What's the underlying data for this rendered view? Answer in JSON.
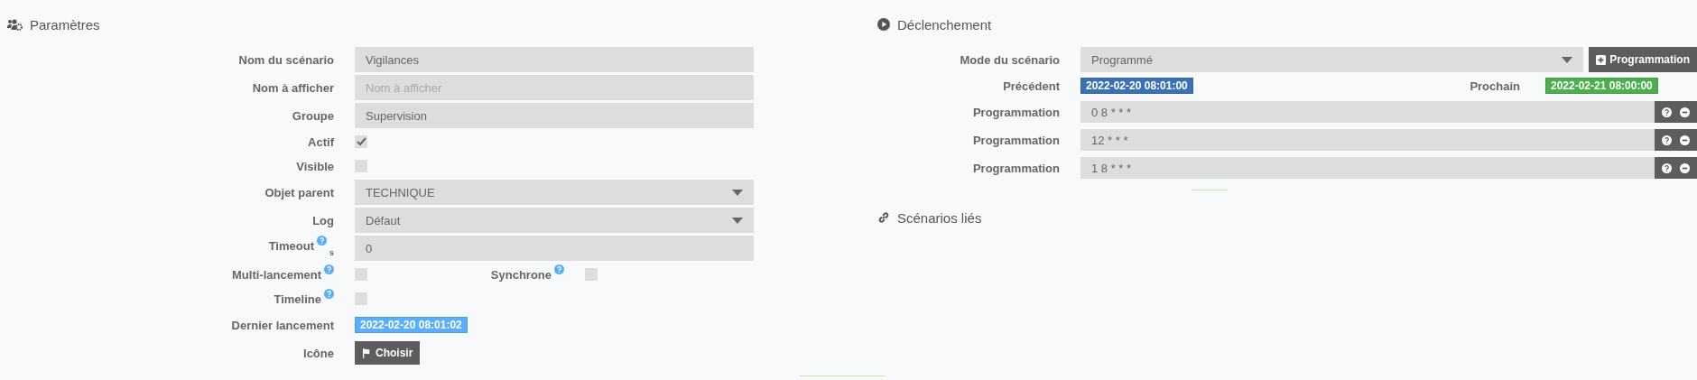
{
  "parameters": {
    "title": "Paramètres",
    "rows": [
      {
        "kind": "text",
        "label": "Nom du scénario",
        "value": "Vigilances"
      },
      {
        "kind": "text",
        "label": "Nom à afficher",
        "placeholder": "Nom à afficher"
      },
      {
        "kind": "text",
        "label": "Groupe",
        "value": "Supervision"
      },
      {
        "kind": "checkbox",
        "label": "Actif",
        "checked": true
      },
      {
        "kind": "checkbox",
        "label": "Visible",
        "checked": false
      },
      {
        "kind": "select",
        "label": "Objet parent",
        "value": "TECHNIQUE"
      },
      {
        "kind": "select",
        "label": "Log",
        "value": "Défaut"
      },
      {
        "kind": "text",
        "label": "Timeout",
        "help": true,
        "unit": "s",
        "value": "0"
      },
      {
        "kind": "checkbox",
        "label": "Multi-lancement",
        "help": true,
        "checked": false,
        "extra": {
          "label": "Synchrone",
          "help": true,
          "checked": false
        }
      },
      {
        "kind": "checkbox",
        "label": "Timeline",
        "help": true,
        "checked": false
      },
      {
        "kind": "badge",
        "label": "Dernier lancement",
        "value": "2022-02-20 08:01:02",
        "color": "#5aaefa"
      },
      {
        "kind": "button",
        "label": "Icône",
        "value": "Choisir"
      }
    ]
  },
  "trigger": {
    "title": "Déclenchement",
    "mode": {
      "label": "Mode du scénario",
      "value": "Programmé",
      "button": "Programmation"
    },
    "runs": [
      {
        "label": "Précédent",
        "value": "2022-02-20 08:01:00",
        "color": "#3a73b5"
      },
      {
        "label": "Prochain",
        "value": "2022-02-21 08:00:00",
        "color": "#4cae4c"
      }
    ],
    "schedules": [
      {
        "label": "Programmation",
        "value": "0 8 * * *"
      },
      {
        "label": "Programmation",
        "value": "12 * * *"
      },
      {
        "label": "Programmation",
        "value": "1 8 * * *"
      }
    ]
  },
  "linked": {
    "title": "Scénarios liés"
  }
}
